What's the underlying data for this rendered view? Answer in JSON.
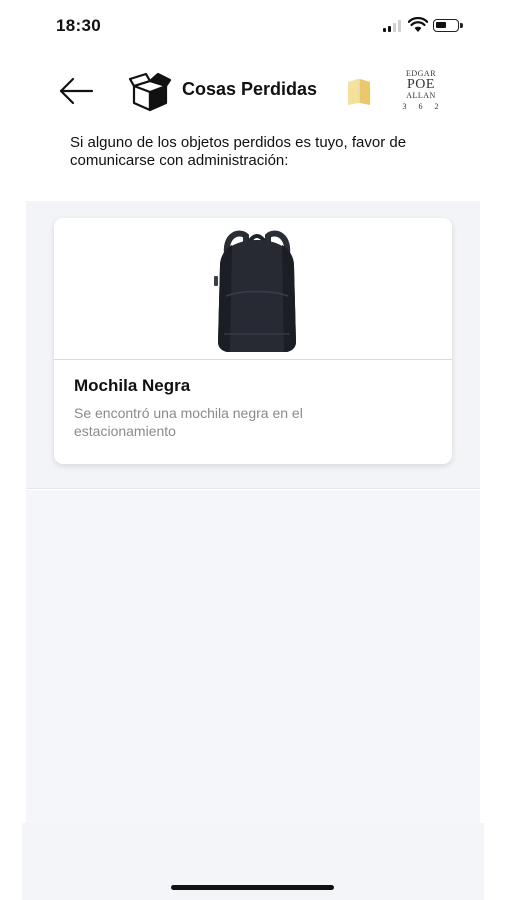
{
  "status_bar": {
    "time": "18:30",
    "icons": [
      "signal-icon",
      "wifi-icon",
      "battery-icon"
    ]
  },
  "header": {
    "back_icon": "arrow-left-icon",
    "title_icon": "box-icon",
    "title": "Cosas Perdidas",
    "book_icon": "book-icon",
    "logo": {
      "line1": "EDGAR",
      "line2": "POE",
      "line3": "ALLAN",
      "line4": "3 6 2"
    }
  },
  "intro_text": "Si alguno de los objetos perdidos es tuyo, favor de comunicarse con administración:",
  "items": [
    {
      "image": "backpack-photo",
      "title": "Mochila Negra",
      "description": "Se encontró una mochila negra en el estacionamiento"
    }
  ],
  "colors": {
    "background": "#ffffff",
    "list_background": "#f3f4f8",
    "text": "#111111",
    "muted_text": "#8a8a8a",
    "book_icon": "#f2d98a"
  }
}
